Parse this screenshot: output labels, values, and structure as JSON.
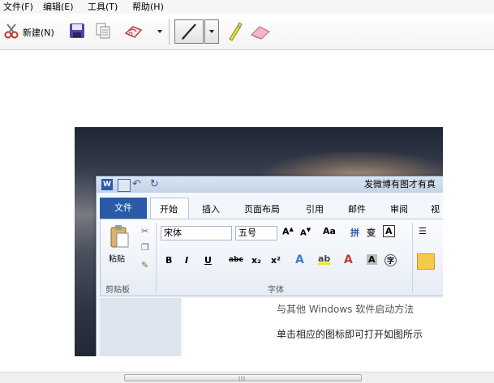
{
  "menu": {
    "items": [
      {
        "label": "文件(F)"
      },
      {
        "label": "编辑(E)"
      },
      {
        "label": "工具(T)"
      },
      {
        "label": "帮助(H)"
      }
    ]
  },
  "toolbar": {
    "new_label": "新建(N)",
    "icons": [
      "scissors-icon",
      "save-icon",
      "copy-icon",
      "send-icon",
      "pen-icon",
      "highlighter-icon",
      "eraser-icon"
    ]
  },
  "screenshot": {
    "word": {
      "title_text": "发微博有图才有真",
      "file_tab": "文件",
      "tabs": [
        "开始",
        "插入",
        "页面布局",
        "引用",
        "邮件",
        "审阅",
        "视"
      ],
      "paste_label": "粘贴",
      "clipboard_group": "剪贴板",
      "font_group": "字体",
      "font_name": "宋体",
      "font_size": "五号",
      "buttons": [
        "B",
        "I",
        "U",
        "abc",
        "x₂",
        "x²"
      ],
      "doc_line_1": "与其他 Windows 软件启动方法",
      "doc_line_2": "单击相应的图标即可打开如图所示"
    }
  },
  "colors": {
    "file_tab_bg": "#2a5aa8",
    "accent_red": "#c0392b"
  }
}
